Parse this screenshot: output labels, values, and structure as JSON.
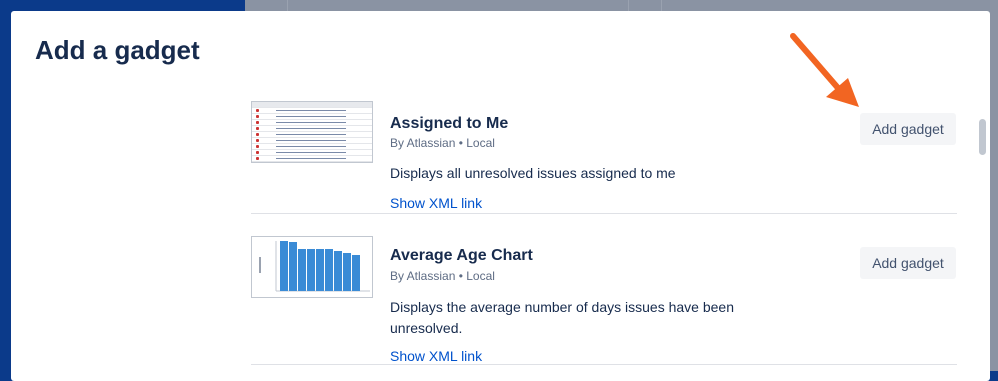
{
  "dialog": {
    "title": "Add a gadget"
  },
  "gadgets": [
    {
      "title": "Assigned to Me",
      "meta": "By Atlassian • Local",
      "description": "Displays all unresolved issues assigned to me",
      "link": "Show XML link",
      "button": "Add gadget",
      "thumbnail": "issue-list-thumbnail"
    },
    {
      "title": "Average Age Chart",
      "meta": "By Atlassian • Local",
      "description": "Displays the average number of days issues have been unresolved.",
      "link": "Show XML link",
      "button": "Add gadget",
      "thumbnail": "bar-chart-thumbnail"
    }
  ],
  "annotation": {
    "color": "#f26522",
    "icon": "arrow-pointer-icon"
  }
}
